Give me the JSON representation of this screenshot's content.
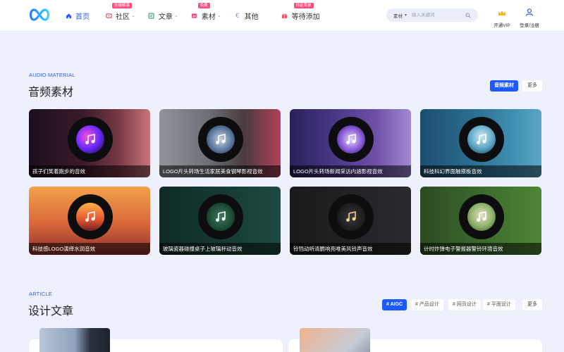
{
  "header": {
    "nav": [
      {
        "label": "首页",
        "icon": "home-icon",
        "active": true
      },
      {
        "label": "社区",
        "icon": "chat-icon",
        "badge": "答疑解惑",
        "dropdown": true
      },
      {
        "label": "文章",
        "icon": "article-icon",
        "dropdown": true
      },
      {
        "label": "素材",
        "icon": "material-icon",
        "badge": "免费",
        "dropdown": true
      },
      {
        "label": "其他",
        "icon": "currency-icon"
      },
      {
        "label": "等待添加",
        "icon": "gift-icon",
        "badge": "待定菜单"
      }
    ],
    "search": {
      "category": "素材",
      "placeholder": "输入关键词"
    },
    "vip_label": "开通VIP",
    "login_label": "登录/注册"
  },
  "audio_section": {
    "eyebrow": "AUDIO MATERIAL",
    "title": "音频素材",
    "active_button": "音频素材",
    "more_label": "更多",
    "cards": [
      {
        "title": "孩子们笑着跑步的音效"
      },
      {
        "title": "LOGO片头转场生活家居美食钢琴影视音效"
      },
      {
        "title": "LOGO片头转场新闻采访内涵影视音效"
      },
      {
        "title": "科技科幻界面触摸板音效"
      },
      {
        "title": "科技感LOGO演绎水润音效"
      },
      {
        "title": "玻璃瓷器碰撞桌子上玻璃杯动音效"
      },
      {
        "title": "铃铛动听清脆响亮唯美风铃声音效"
      },
      {
        "title": "计时炸弹电子警报器警铃环境音效"
      }
    ]
  },
  "article_section": {
    "eyebrow": "ARTICLE",
    "title": "设计文章",
    "tags": [
      "# AIGC",
      "# 产品设计",
      "# 网页设计",
      "# 平面设计"
    ],
    "more_label": "更多"
  },
  "colors": {
    "accent": "#1e59ff",
    "badge": "#ff4d7d",
    "background": "#eef1fb"
  }
}
